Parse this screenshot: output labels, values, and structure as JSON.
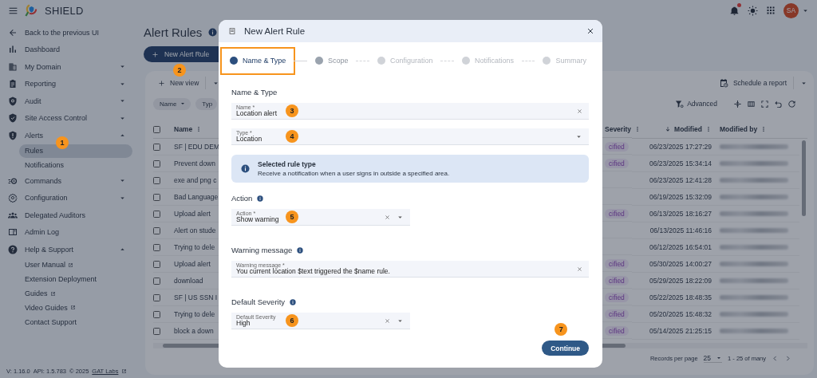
{
  "topbar": {
    "app_name": "SHIELD",
    "notifications_unread": true,
    "avatar_initials": "SA"
  },
  "sidebar": {
    "items": [
      {
        "label": "Back to the previous UI",
        "selected": false
      },
      {
        "label": "Dashboard",
        "selected": false
      },
      {
        "label": "My Domain",
        "selected": false,
        "expanded": false
      },
      {
        "label": "Reporting",
        "selected": false,
        "expanded": false
      },
      {
        "label": "Audit",
        "selected": false,
        "expanded": false
      },
      {
        "label": "Site Access Control",
        "selected": false,
        "expanded": false
      },
      {
        "label": "Alerts",
        "selected": false,
        "expanded": true,
        "children": [
          {
            "label": "Rules",
            "selected": true,
            "marker": "1"
          },
          {
            "label": "Notifications",
            "selected": false
          }
        ]
      },
      {
        "label": "Commands",
        "selected": false,
        "expanded": false
      },
      {
        "label": "Configuration",
        "selected": false,
        "expanded": false
      },
      {
        "label": "Delegated Auditors",
        "selected": false
      },
      {
        "label": "Admin Log",
        "selected": false
      },
      {
        "label": "Help & Support",
        "selected": false,
        "expanded": true,
        "children": [
          {
            "label": "User Manual",
            "selected": false,
            "external": true
          },
          {
            "label": "Extension Deployment",
            "selected": false
          },
          {
            "label": "Guides",
            "selected": false,
            "external": true
          },
          {
            "label": "Video Guides",
            "selected": false,
            "external": true
          },
          {
            "label": "Contact Support",
            "selected": false
          }
        ]
      }
    ],
    "footer": {
      "version": "V: 1.16.0",
      "api": "API: 1.5.783",
      "copyright": "© 2025",
      "link": "GAT Labs"
    }
  },
  "page": {
    "title": "Alert Rules",
    "new_button": {
      "label": "New Alert Rule",
      "marker": "2"
    }
  },
  "table": {
    "new_view": "New view",
    "schedule": "Schedule a report",
    "advanced": "Advanced",
    "filters": [
      {
        "label": "Name",
        "dropdown": true
      },
      {
        "label": "Typ",
        "dropdown": false
      }
    ],
    "all_checked": false,
    "columns": [
      {
        "label": "Name"
      },
      {
        "label": "Severity"
      },
      {
        "label": "Modified",
        "sorted": true
      },
      {
        "label": "Modified by"
      }
    ],
    "rows": [
      {
        "checked": false,
        "name": "SF | EDU DEM",
        "severity": "cified",
        "modified": "06/23/2025 17:27:29"
      },
      {
        "checked": false,
        "name": "Prevent down",
        "severity": "cified",
        "modified": "06/23/2025 15:34:14"
      },
      {
        "checked": false,
        "name": "exe and png c",
        "modified": "06/23/2025 12:41:28"
      },
      {
        "checked": false,
        "name": "Bad Language",
        "modified": "06/19/2025 15:32:09"
      },
      {
        "checked": false,
        "name": "Upload alert",
        "severity": "cified",
        "modified": "06/13/2025 18:16:27"
      },
      {
        "checked": false,
        "name": "Alert on stude",
        "modified": "06/13/2025 11:46:16"
      },
      {
        "checked": false,
        "name": "Trying to dele",
        "modified": "06/12/2025 16:54:01"
      },
      {
        "checked": false,
        "name": "Upload alert",
        "severity": "cified",
        "modified": "05/30/2025 14:00:27"
      },
      {
        "checked": false,
        "name": "download",
        "severity": "cified",
        "modified": "05/29/2025 18:22:09"
      },
      {
        "checked": false,
        "name": "SF | US SSN I",
        "severity": "cified",
        "modified": "05/22/2025 18:48:35"
      },
      {
        "checked": false,
        "name": "Trying to dele",
        "severity": "cified",
        "modified": "05/20/2025 15:48:32"
      },
      {
        "checked": false,
        "name": "block a down",
        "severity": "cified",
        "modified": "05/14/2025 21:25:15"
      }
    ],
    "footer": {
      "records_label": "Records per page",
      "page_size": "25",
      "range": "1 - 25 of many"
    }
  },
  "dialog": {
    "title": "New Alert Rule",
    "steps": [
      {
        "label": "Name & Type",
        "selected": true,
        "highlighted": true
      },
      {
        "label": "Scope",
        "selected": false,
        "highlighted": false
      },
      {
        "label": "Configuration",
        "selected": false,
        "highlighted": false
      },
      {
        "label": "Notifications",
        "selected": false,
        "highlighted": false
      },
      {
        "label": "Summary",
        "selected": false,
        "highlighted": false
      }
    ],
    "sections": [
      {
        "heading": "Name & Type",
        "info": false,
        "fields": [
          {
            "kind": "text",
            "label": "Name *",
            "value": "Location alert",
            "clearable": true,
            "marker": "3"
          },
          {
            "kind": "select",
            "label": "Type *",
            "value": "Location",
            "clearable": false,
            "marker": "4"
          }
        ],
        "notice": {
          "title": "Selected rule type",
          "text": "Receive a notification when a user signs in outside a specified area."
        }
      },
      {
        "heading": "Action",
        "info": true,
        "fields": [
          {
            "kind": "select",
            "label": "Action *",
            "value": "Show warning",
            "clearable": true,
            "marker": "5"
          }
        ]
      },
      {
        "heading": "Warning message",
        "info": true,
        "fields": [
          {
            "kind": "text",
            "label": "Warning message *",
            "value": "You current location $text triggered the $name rule.",
            "clearable": true
          }
        ]
      },
      {
        "heading": "Default Severity",
        "info": true,
        "fields": [
          {
            "kind": "select",
            "label": "Default Severity",
            "value": "High",
            "clearable": true,
            "marker": "6"
          }
        ]
      }
    ],
    "continue_button": {
      "label": "Continue",
      "marker": "7"
    }
  }
}
